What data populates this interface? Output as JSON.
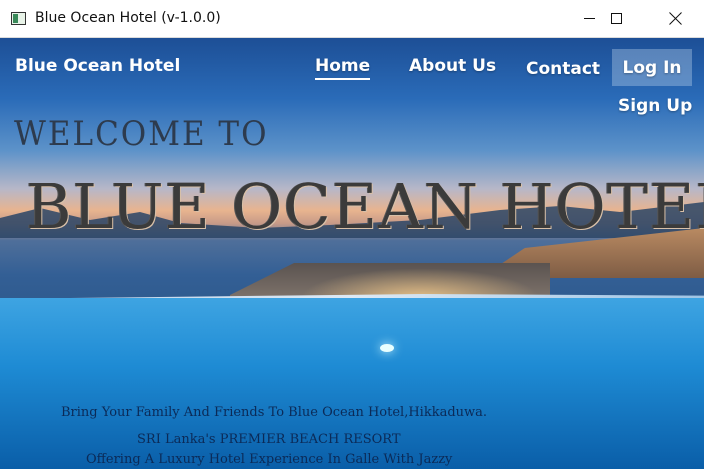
{
  "window": {
    "title": "Blue Ocean Hotel (v-1.0.0)",
    "controls": {
      "minimize": "minimize",
      "maximize": "maximize",
      "close": "close"
    }
  },
  "nav": {
    "brand": "Blue Ocean Hotel",
    "items": [
      {
        "label": "Home",
        "active": true
      },
      {
        "label": "About Us"
      },
      {
        "label": "Contact"
      },
      {
        "label": "Log In"
      },
      {
        "label": "Sign Up"
      }
    ]
  },
  "hero": {
    "welcome": "WELCOME TO",
    "hotel_name": "BLUE OCEAN HOTEL",
    "tagline": "Bring Your Family And Friends To Blue Ocean Hotel,Hikkaduwa.",
    "subline1": "SRI Lanka's PREMIER BEACH RESORT",
    "subline2": "Offering A Luxury Hotel Experience In Galle With Jazzy"
  },
  "colors": {
    "nav_text": "#ffffff",
    "welcome_text": "#2d3b4e",
    "hotel_name_text": "#3b3b3b",
    "tagline_text": "#0b2a57",
    "login_bg": "rgba(200,220,240,0.35)"
  }
}
